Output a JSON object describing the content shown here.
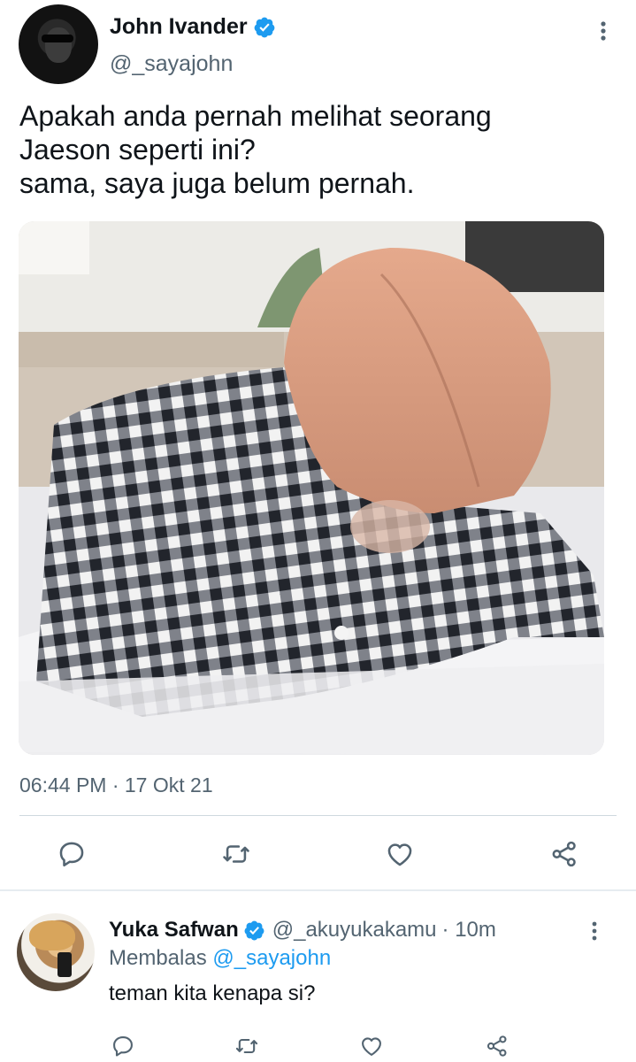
{
  "tweet": {
    "author_name": "John Ivander",
    "author_handle": "@_sayajohn",
    "text": "Apakah anda pernah melihat seorang\nJaeson seperti ini?\nsama, saya juga belum pernah.",
    "timestamp": "06:44 PM · 17 Okt 21",
    "icons": {
      "verified": "verified-badge-icon",
      "more": "more-options-icon",
      "reply": "reply-icon",
      "retweet": "retweet-icon",
      "like": "like-icon",
      "share": "share-icon"
    }
  },
  "reply": {
    "author_name": "Yuka Safwan",
    "author_handle": "@_akuyukakamu",
    "time_ago": "· 10m",
    "replying_label": "Membalas",
    "replying_to": "@_sayajohn",
    "text": "teman kita kenapa si?"
  },
  "colors": {
    "text_primary": "#0f1419",
    "text_secondary": "#536471",
    "accent": "#1d9bf0",
    "divider": "#cfd9de"
  }
}
